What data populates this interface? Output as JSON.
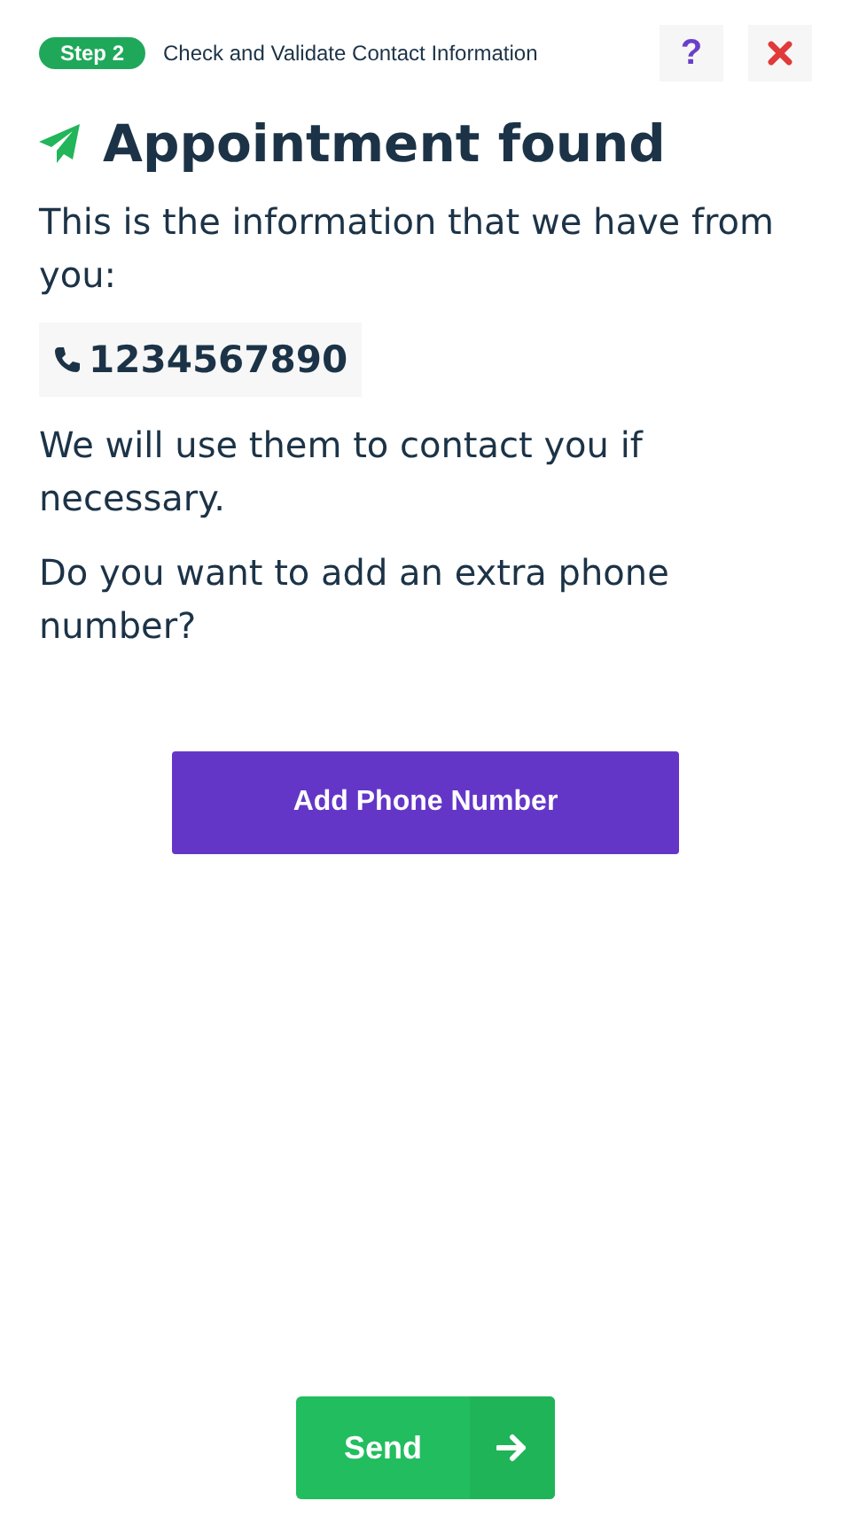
{
  "header": {
    "step_badge": "Step 2",
    "step_title": "Check and Validate Contact Information",
    "help_button": "?"
  },
  "title": "Appointment found",
  "intro": "This is the information that we have from you:",
  "phone": "1234567890",
  "usage_note": "We will use them to contact you if necessary.",
  "question": "Do you want to add an extra phone number?",
  "add_button": "Add Phone Number",
  "send_button": "Send"
}
